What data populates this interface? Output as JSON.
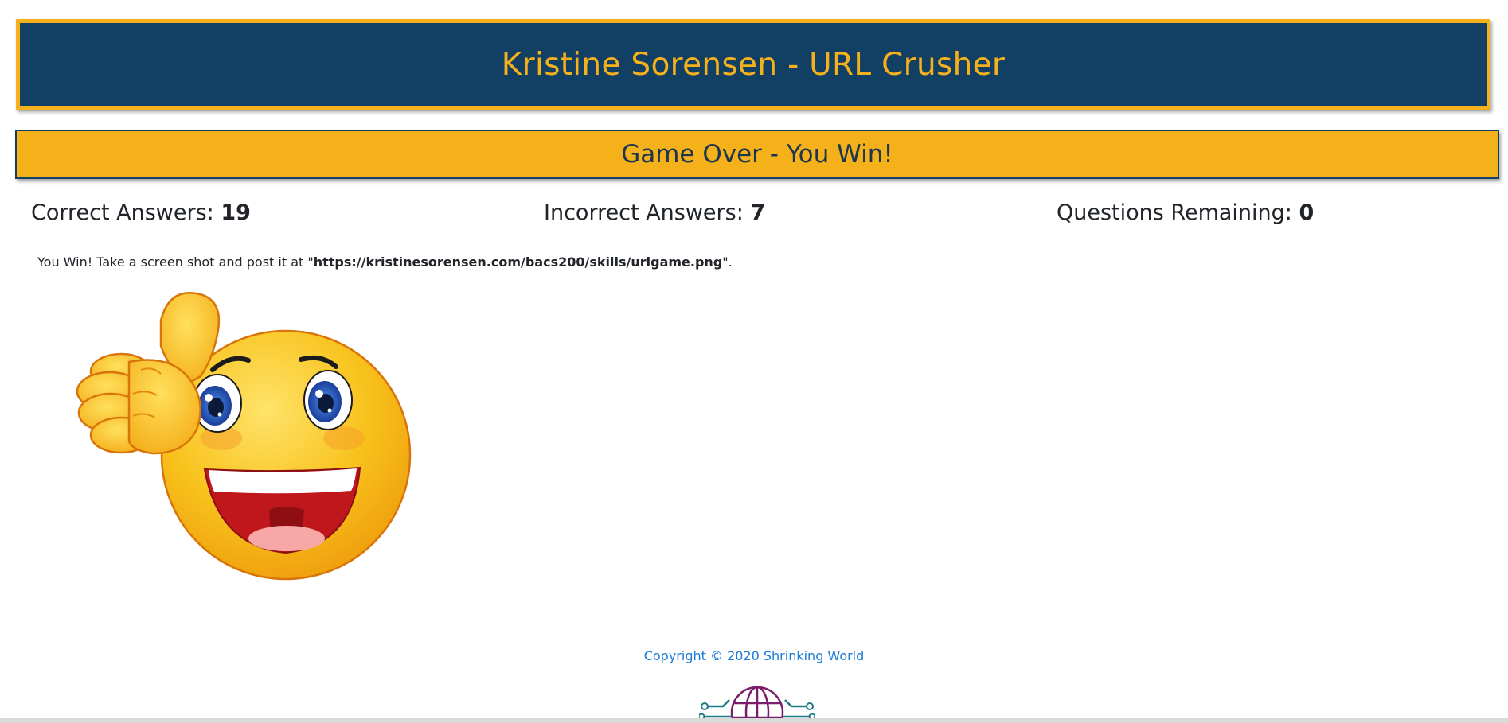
{
  "header": {
    "title": "Kristine Sorensen - URL Crusher"
  },
  "status": {
    "text": "Game Over - You Win!"
  },
  "stats": {
    "correct_label": "Correct Answers:",
    "correct_value": "19",
    "incorrect_label": "Incorrect Answers:",
    "incorrect_value": "7",
    "remaining_label": "Questions Remaining:",
    "remaining_value": "0"
  },
  "message": {
    "prefix": "You Win! Take a screen shot and post it at \"",
    "url": "https://kristinesorensen.com/bacs200/skills/urlgame.png",
    "suffix": "\"."
  },
  "footer": {
    "copyright": "Copyright © 2020 Shrinking World"
  },
  "icons": {
    "win_image": "thumbs-up-smiley-icon",
    "logo": "globe-circuit-logo-icon"
  },
  "colors": {
    "header_bg": "#123f64",
    "accent": "#f4b11b",
    "link": "#1a7ad6"
  }
}
